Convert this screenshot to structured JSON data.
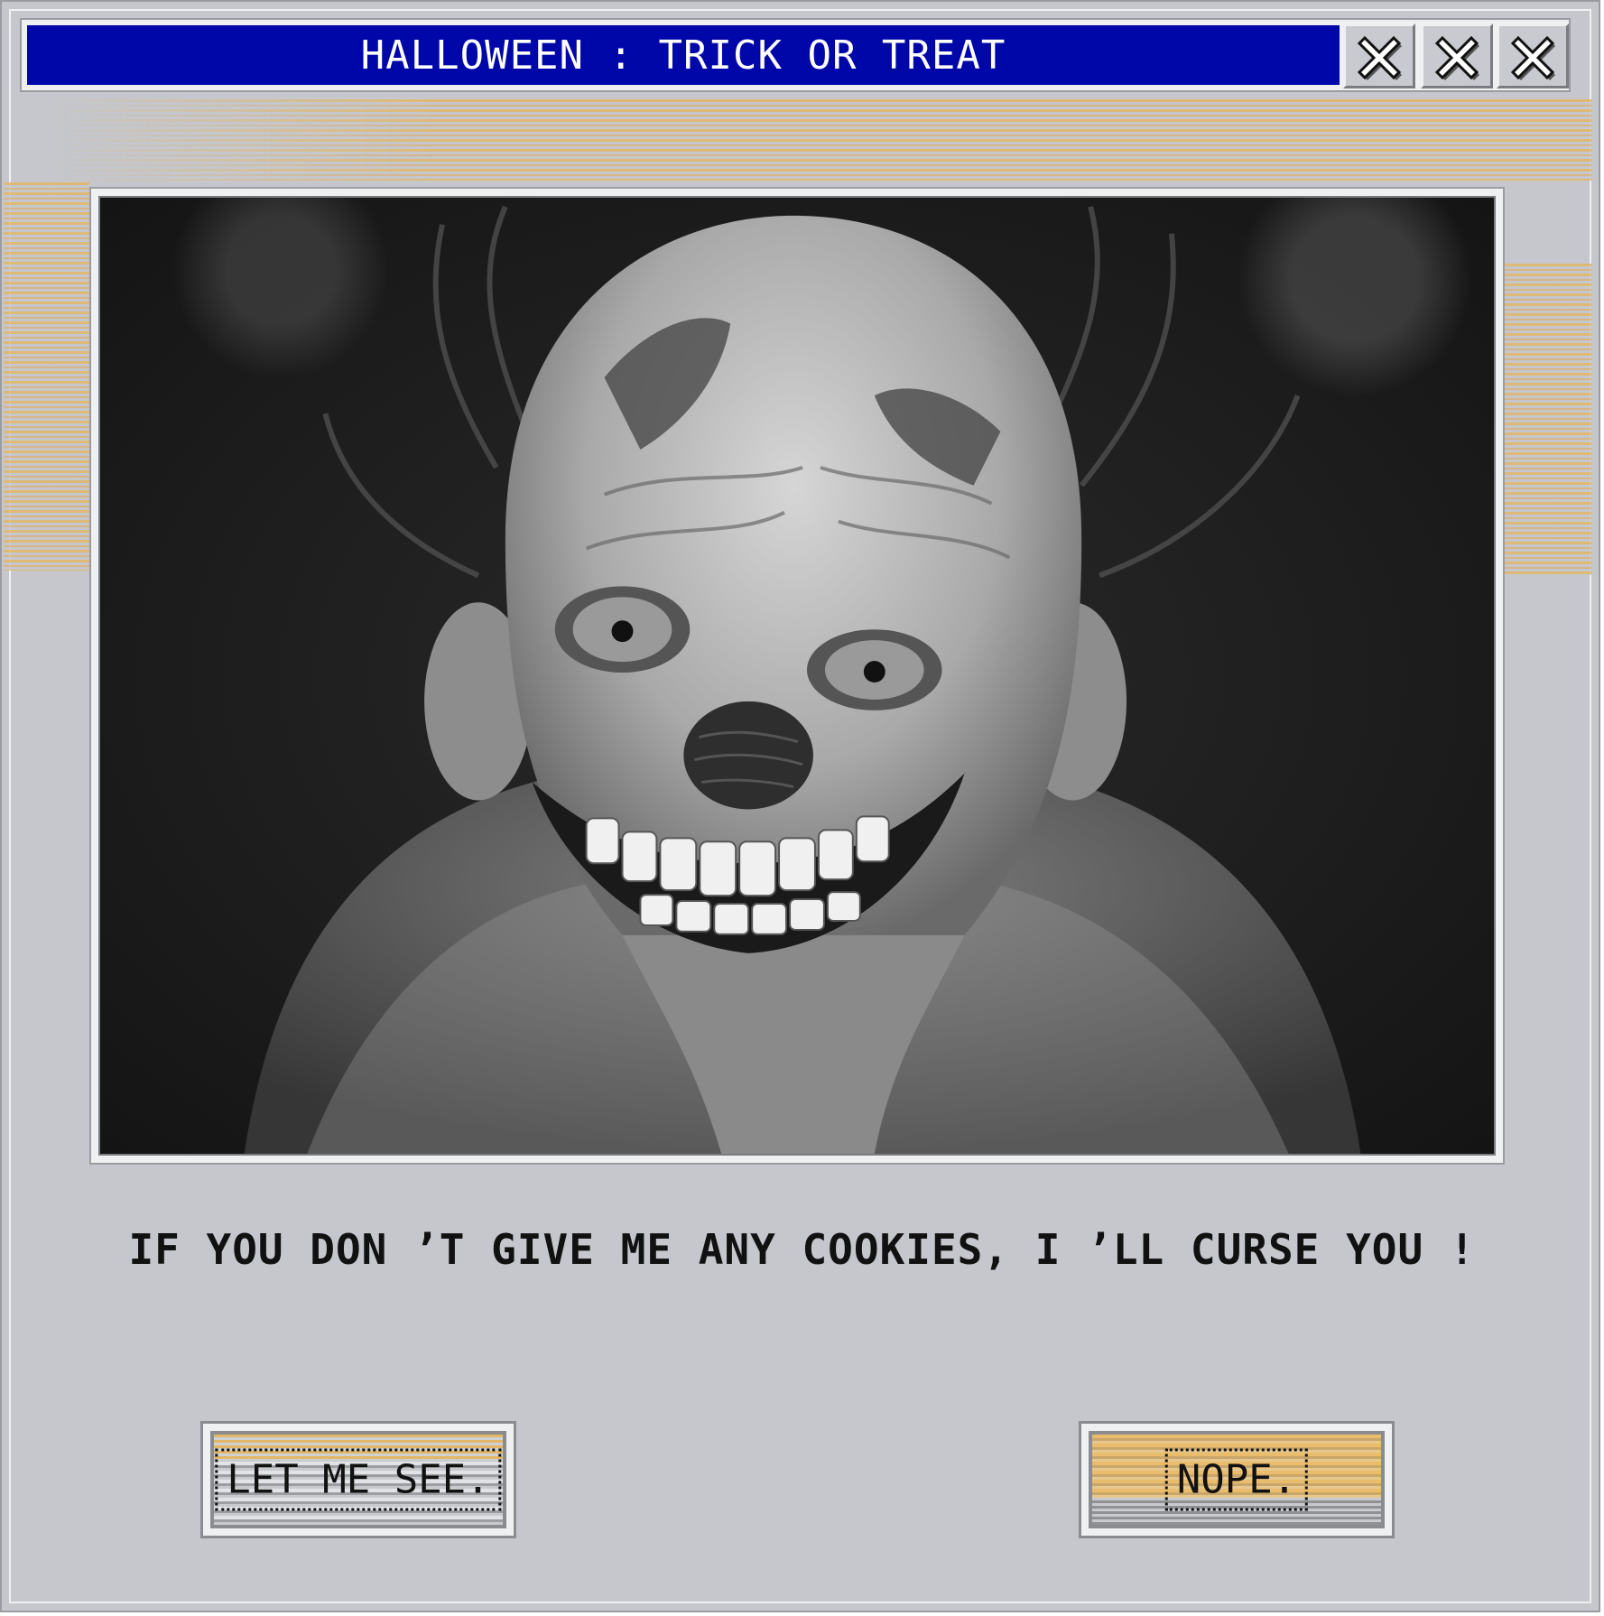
{
  "window": {
    "title": "HALLOWEEN : TRICK OR TREAT",
    "title_bar_color": "#0007a8",
    "background_color": "#c5c7cc",
    "accent_stripe_color": "#e3b766",
    "controls": [
      {
        "icon": "close-icon"
      },
      {
        "icon": "close-icon"
      },
      {
        "icon": "close-icon"
      }
    ]
  },
  "content": {
    "image": {
      "subject": "creepy-clown-mask-photo",
      "style": "black-and-white"
    },
    "message": "IF YOU DON ’T GIVE ME ANY COOKIES, I ’LL CURSE YOU !"
  },
  "buttons": {
    "confirm_label": "LET ME SEE.",
    "decline_label": "NOPE."
  }
}
